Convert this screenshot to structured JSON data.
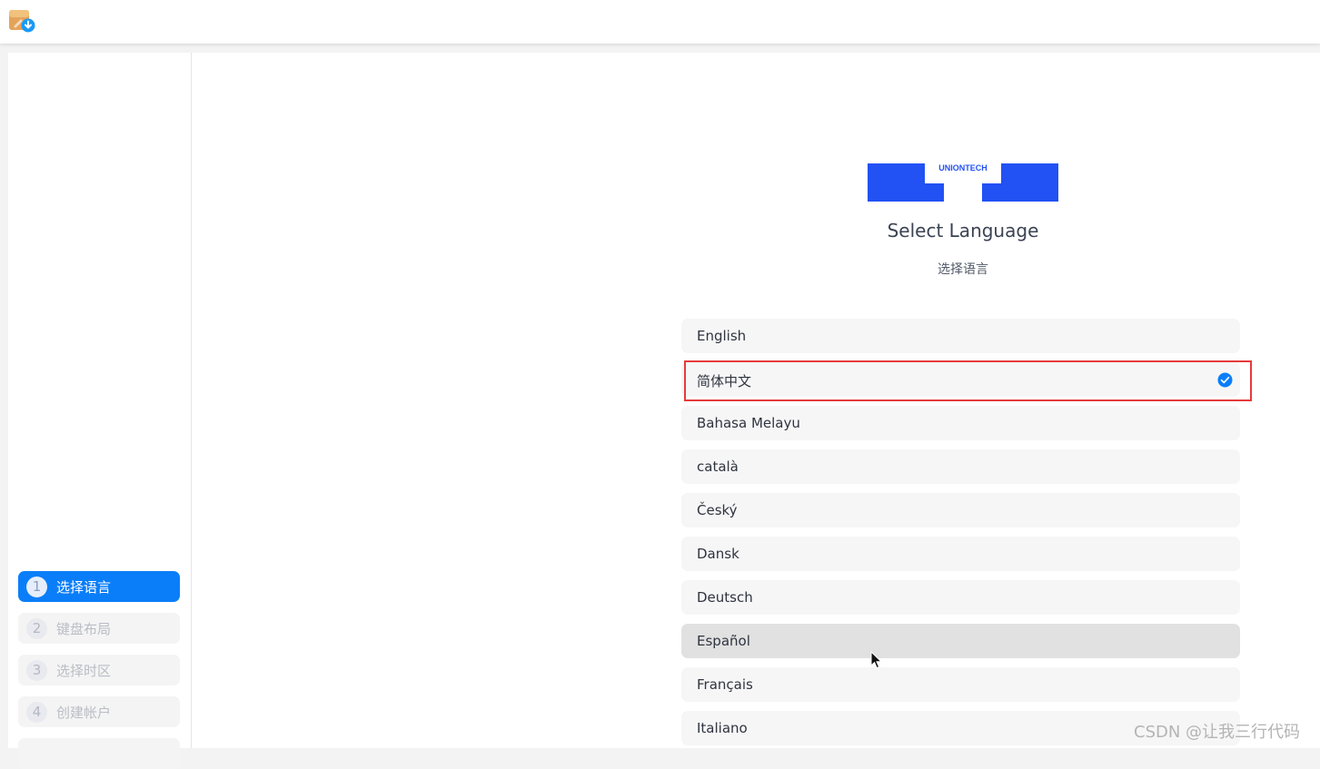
{
  "titlebar": {
    "app_icon": "installer-icon"
  },
  "sidebar": {
    "steps": [
      {
        "num": "1",
        "label": "选择语言",
        "active": true
      },
      {
        "num": "2",
        "label": "键盘布局",
        "active": false
      },
      {
        "num": "3",
        "label": "选择时区",
        "active": false
      },
      {
        "num": "4",
        "label": "创建帐户",
        "active": false
      }
    ]
  },
  "main": {
    "logo_text": "UNIONTECH",
    "title": "Select Language",
    "subtitle": "选择语言",
    "languages": [
      {
        "label": "English"
      },
      {
        "label": "简体中文",
        "selected": true
      },
      {
        "label": "Bahasa Melayu"
      },
      {
        "label": "català"
      },
      {
        "label": "Český"
      },
      {
        "label": "Dansk"
      },
      {
        "label": "Deutsch"
      },
      {
        "label": "Español",
        "hovered": true
      },
      {
        "label": "Français"
      },
      {
        "label": "Italiano"
      }
    ]
  },
  "watermark": "CSDN @让我三行代码",
  "colors": {
    "accent": "#0a7ef8",
    "logo_blue": "#2251f4",
    "highlight_red": "#e53b3b"
  }
}
